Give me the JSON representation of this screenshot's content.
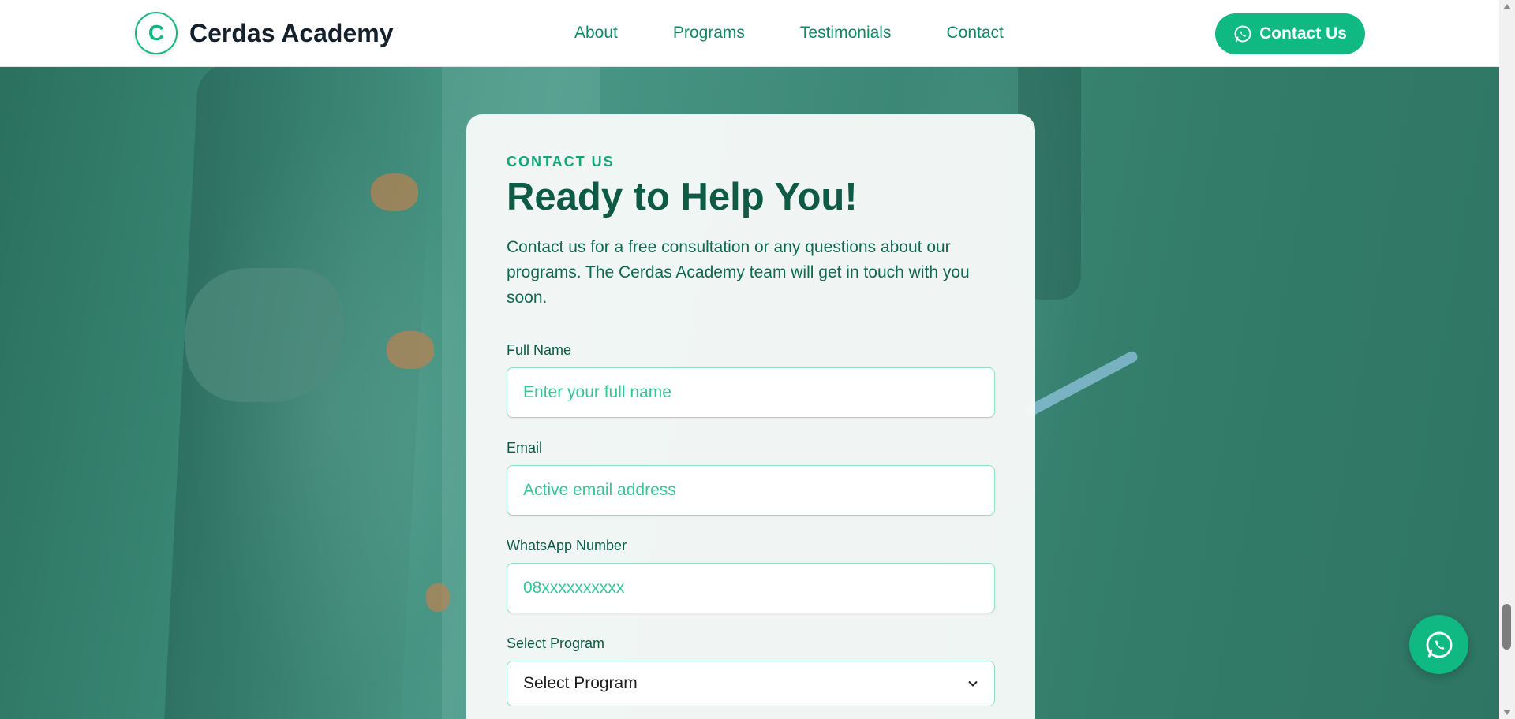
{
  "header": {
    "brand_initial": "C",
    "brand_name": "Cerdas Academy",
    "nav": [
      "About",
      "Programs",
      "Testimonials",
      "Contact"
    ],
    "cta_label": "Contact Us"
  },
  "contact": {
    "eyebrow": "CONTACT US",
    "title": "Ready to Help You!",
    "description": "Contact us for a free consultation or any questions about our programs. The Cerdas Academy team will get in touch with you soon.",
    "fields": {
      "full_name": {
        "label": "Full Name",
        "placeholder": "Enter your full name"
      },
      "email": {
        "label": "Email",
        "placeholder": "Active email address"
      },
      "whatsapp": {
        "label": "WhatsApp Number",
        "placeholder": "08xxxxxxxxxx"
      },
      "program": {
        "label": "Select Program",
        "selected": "Select Program"
      }
    }
  },
  "colors": {
    "accent": "#10b981",
    "heading": "#0e5a44",
    "overlay": "#2f7a67"
  },
  "icons": {
    "cta_icon": "whatsapp-icon",
    "fab_icon": "whatsapp-icon",
    "select_icon": "chevron-down-icon"
  }
}
